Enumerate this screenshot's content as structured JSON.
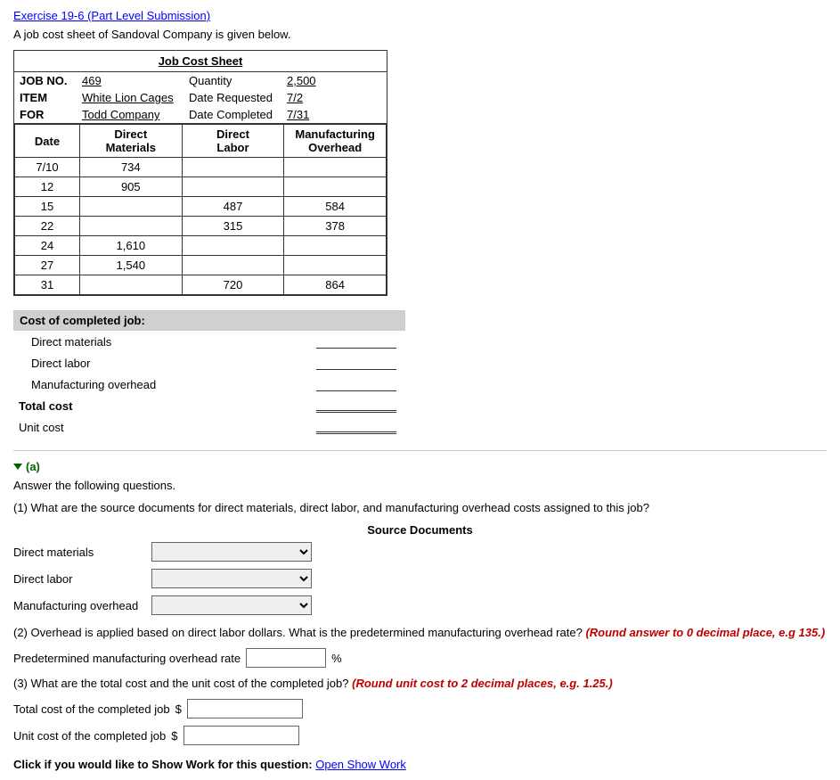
{
  "exercise": {
    "title": "Exercise 19-6 (Part Level Submission)",
    "intro": "A job cost sheet of Sandoval Company is given below."
  },
  "jobCostSheet": {
    "title": "Job Cost Sheet",
    "fields": {
      "jobNo": {
        "label": "JOB NO.",
        "value": "469"
      },
      "quantity": {
        "label": "Quantity",
        "value": "2,500"
      },
      "item": {
        "label": "ITEM",
        "value": "White Lion Cages"
      },
      "dateRequested": {
        "label": "Date Requested",
        "value": "7/2"
      },
      "for": {
        "label": "FOR",
        "value": "Todd Company"
      },
      "dateCompleted": {
        "label": "Date Completed",
        "value": "7/31"
      }
    },
    "tableHeaders": {
      "date": "Date",
      "directMaterials": "Direct\nMaterials",
      "directLabor": "Direct\nLabor",
      "manufacturingOverhead": "Manufacturing\nOverhead"
    },
    "rows": [
      {
        "date": "7/10",
        "materials": "734",
        "labor": "",
        "overhead": ""
      },
      {
        "date": "12",
        "materials": "905",
        "labor": "",
        "overhead": ""
      },
      {
        "date": "15",
        "materials": "",
        "labor": "487",
        "overhead": "584"
      },
      {
        "date": "22",
        "materials": "",
        "labor": "315",
        "overhead": "378"
      },
      {
        "date": "24",
        "materials": "1,610",
        "labor": "",
        "overhead": ""
      },
      {
        "date": "27",
        "materials": "1,540",
        "labor": "",
        "overhead": ""
      },
      {
        "date": "31",
        "materials": "",
        "labor": "720",
        "overhead": "864"
      }
    ]
  },
  "costSection": {
    "header": "Cost of completed job:",
    "items": [
      {
        "label": "Direct materials",
        "value": ""
      },
      {
        "label": "Direct labor",
        "value": ""
      },
      {
        "label": "Manufacturing overhead",
        "value": ""
      }
    ],
    "totalLabel": "Total cost",
    "unitLabel": "Unit cost"
  },
  "partA": {
    "header": "(a)",
    "instruction": "Answer the following questions.",
    "q1": {
      "text": "(1) What are the source documents for direct materials, direct labor, and manufacturing overhead costs assigned to this job?",
      "tableTitle": "Source Documents",
      "rows": [
        {
          "label": "Direct materials"
        },
        {
          "label": "Direct labor"
        },
        {
          "label": "Manufacturing overhead"
        }
      ]
    },
    "q2": {
      "text": "(2) Overhead is applied based on direct labor dollars. What is the predetermined manufacturing overhead rate?",
      "highlight": "(Round answer to 0 decimal place, e.g 135.)",
      "label": "Predetermined manufacturing overhead rate",
      "unit": "%"
    },
    "q3": {
      "text": "(3) What are the total cost and the unit cost of the completed job?",
      "highlight": "(Round unit cost to 2 decimal places, e.g. 1.25.)",
      "totalLabel": "Total cost of the completed job",
      "unitLabel": "Unit cost of the completed job",
      "dollarSign": "$"
    }
  },
  "showWork": {
    "label": "Click if you would like to Show Work for this question:",
    "linkText": "Open Show Work"
  }
}
